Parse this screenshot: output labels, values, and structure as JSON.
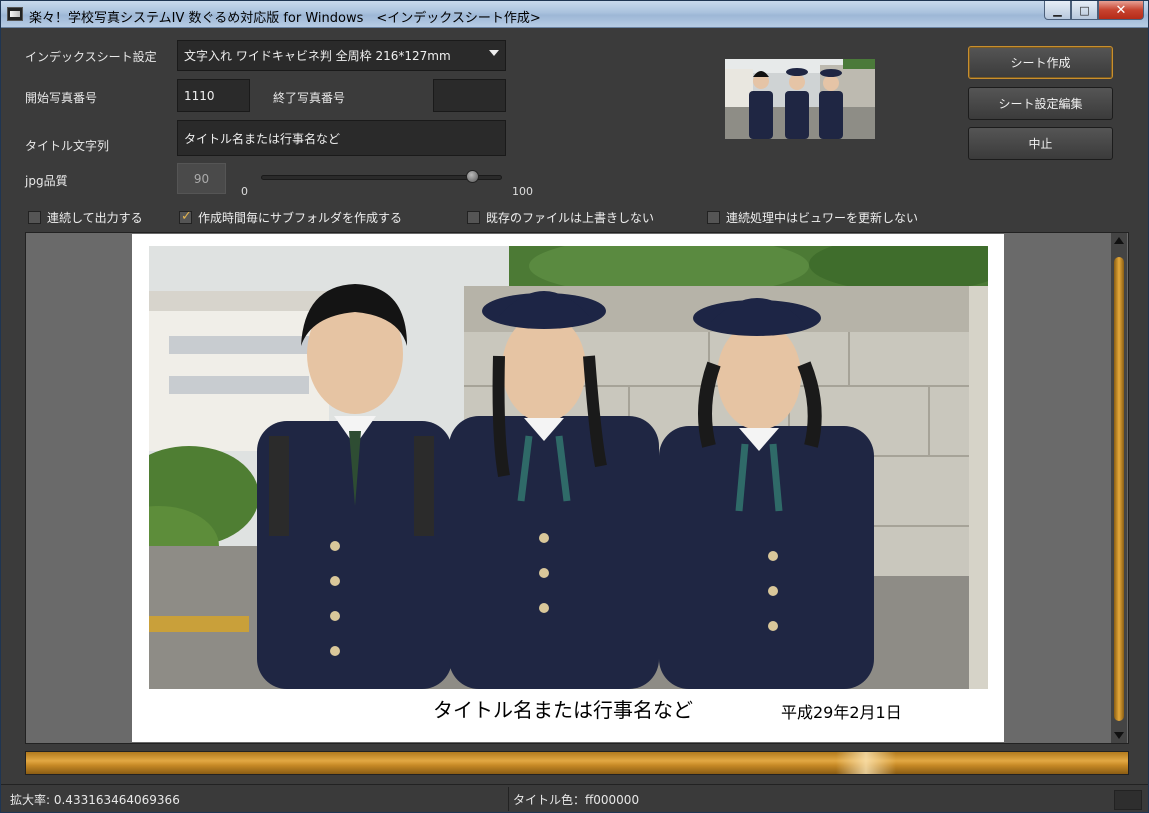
{
  "window": {
    "title": "楽々！学校写真システムIV 数ぐるめ対応版 for Windows　<インデックスシート作成>",
    "min_label": "▁",
    "max_label": "□",
    "close_label": "✕"
  },
  "form": {
    "index_setting_label": "インデックスシート設定",
    "index_setting_value": "文字入れ  ワイドキャビネ判  全周枠 216*127mm",
    "start_no_label": "開始写真番号",
    "start_no_value": "1110",
    "end_no_label": "終了写真番号",
    "end_no_value": "",
    "title_label": "タイトル文字列",
    "title_value": "タイトル名または行事名など",
    "jpg_label": "jpg品質",
    "jpg_value": "90",
    "slider_min": "0",
    "slider_max": "100",
    "slider_value": 90
  },
  "checkboxes": {
    "continuous": {
      "label": "連続して出力する",
      "checked": false
    },
    "subfolder": {
      "label": "作成時間毎にサブフォルダを作成する",
      "checked": true
    },
    "no_overwrite": {
      "label": "既存のファイルは上書きしない",
      "checked": false
    },
    "no_viewer_update": {
      "label": "連続処理中はビュワーを更新しない",
      "checked": false
    }
  },
  "buttons": {
    "create": "シート作成",
    "edit": "シート設定編集",
    "cancel": "中止"
  },
  "preview": {
    "sheet_title": "タイトル名または行事名など",
    "sheet_date": "平成29年2月1日"
  },
  "status": {
    "zoom": "拡大率: 0.433163464069366",
    "title_color": "タイトル色：ff000000"
  },
  "colors": {
    "accent": "#e2a843",
    "background": "#3b3b3b"
  }
}
